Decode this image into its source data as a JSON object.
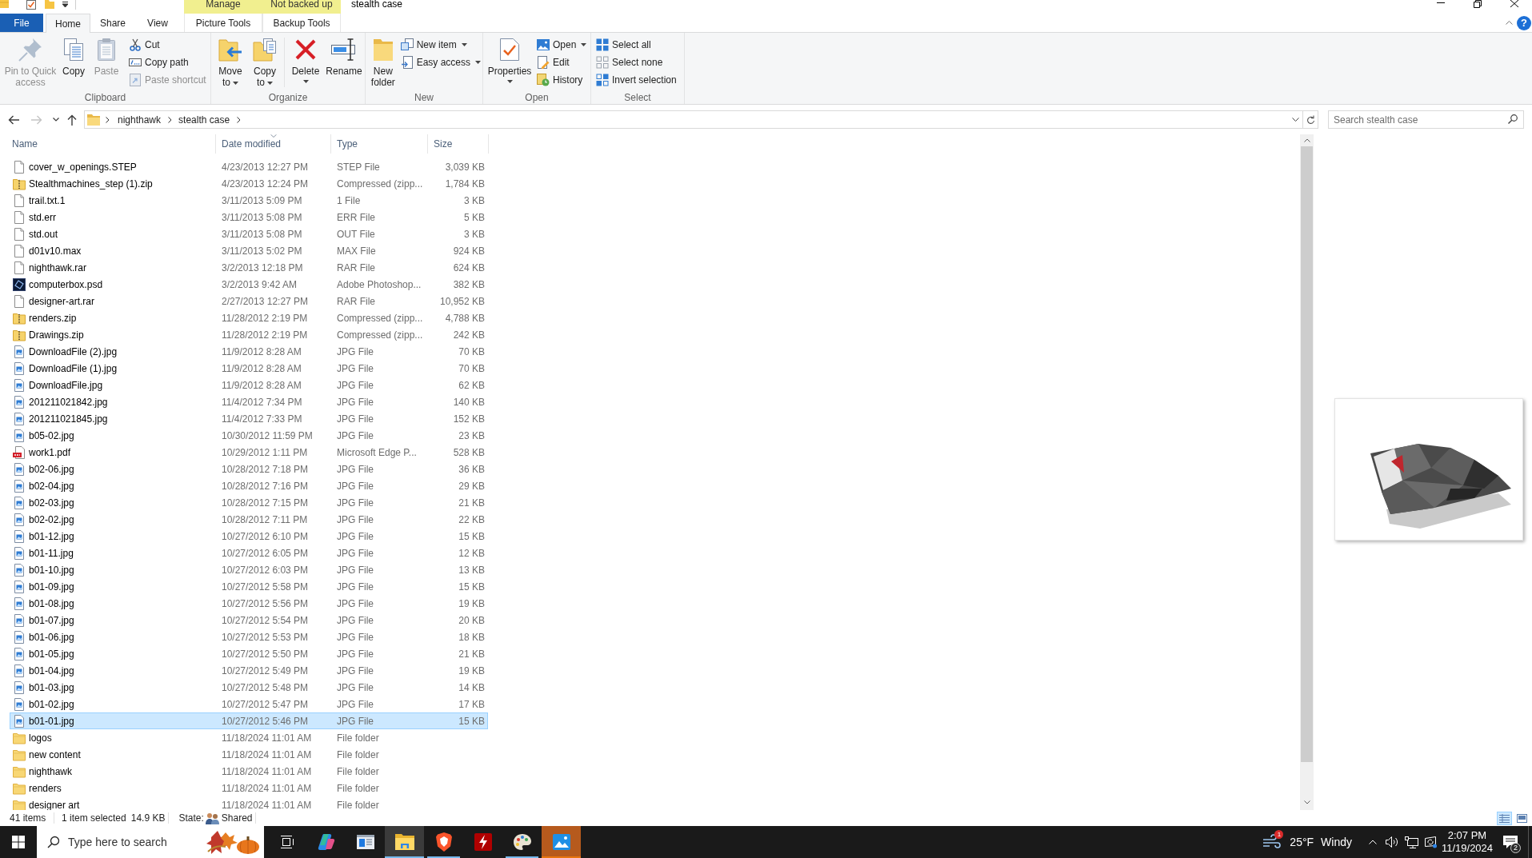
{
  "window": {
    "title": "stealth case"
  },
  "ribbon": {
    "tabs": [
      {
        "label": "File",
        "kind": "file",
        "selected": false
      },
      {
        "label": "Home",
        "kind": "standard",
        "selected": true
      },
      {
        "label": "Share",
        "kind": "standard",
        "selected": false
      },
      {
        "label": "View",
        "kind": "standard",
        "selected": false
      },
      {
        "label": "Picture Tools",
        "kind": "contextual",
        "header": "Manage",
        "selected": false
      },
      {
        "label": "Backup Tools",
        "kind": "contextual",
        "header": "Not backed up",
        "selected": false
      }
    ],
    "help_button": {
      "label": "?"
    },
    "groups": [
      {
        "label": "Clipboard",
        "buttons": [
          {
            "label": "Pin to Quick access",
            "kind": "large",
            "disabled": true
          },
          {
            "label": "Copy",
            "kind": "large",
            "disabled": false
          },
          {
            "label": "Paste",
            "kind": "large",
            "disabled": true
          },
          {
            "label": "Cut",
            "kind": "small",
            "disabled": false
          },
          {
            "label": "Copy path",
            "kind": "small",
            "disabled": false
          },
          {
            "label": "Paste shortcut",
            "kind": "small",
            "disabled": true
          }
        ]
      },
      {
        "label": "Organize",
        "buttons": [
          {
            "label": "Move to",
            "kind": "large_menu",
            "disabled": false
          },
          {
            "label": "Copy to",
            "kind": "large_menu",
            "disabled": false
          },
          {
            "label": "Delete",
            "kind": "large_split",
            "disabled": false
          },
          {
            "label": "Rename",
            "kind": "large",
            "disabled": false
          }
        ]
      },
      {
        "label": "New",
        "buttons": [
          {
            "label": "New folder",
            "kind": "large",
            "disabled": false
          },
          {
            "label": "New item",
            "kind": "small_menu",
            "disabled": false
          },
          {
            "label": "Easy access",
            "kind": "small_menu",
            "disabled": false
          }
        ]
      },
      {
        "label": "Open",
        "buttons": [
          {
            "label": "Properties",
            "kind": "large_split",
            "disabled": false
          },
          {
            "label": "Open",
            "kind": "small_menu",
            "disabled": false
          },
          {
            "label": "Edit",
            "kind": "small",
            "disabled": false
          },
          {
            "label": "History",
            "kind": "small",
            "disabled": false
          }
        ]
      },
      {
        "label": "Select",
        "buttons": [
          {
            "label": "Select all",
            "kind": "small",
            "disabled": false
          },
          {
            "label": "Select none",
            "kind": "small",
            "disabled": false
          },
          {
            "label": "Invert selection",
            "kind": "small",
            "disabled": false
          }
        ]
      }
    ]
  },
  "address_bar": {
    "nav_buttons": [
      {
        "kind": "back",
        "disabled": false
      },
      {
        "kind": "forward",
        "disabled": true
      },
      {
        "kind": "recent",
        "disabled": false
      },
      {
        "kind": "up",
        "disabled": false
      }
    ],
    "path": [
      "nighthawk",
      "stealth case"
    ]
  },
  "search": {
    "placeholder": "Search stealth case"
  },
  "file_list": {
    "columns": [
      {
        "label": "Name",
        "sorted": false
      },
      {
        "label": "Date modified",
        "sorted": true
      },
      {
        "label": "Type",
        "sorted": false
      },
      {
        "label": "Size",
        "sorted": false
      }
    ],
    "rows": [
      {
        "name": "cover_w_openings.STEP",
        "date_modified": "4/23/2013 12:27 PM",
        "type": "STEP File",
        "size": "3,039 KB",
        "kind": "document",
        "selected": false
      },
      {
        "name": "Stealthmachines_step (1).zip",
        "date_modified": "4/23/2013 12:24 PM",
        "type": "Compressed (zipp...",
        "size": "1,784 KB",
        "kind": "archive",
        "selected": false
      },
      {
        "name": "trail.txt.1",
        "date_modified": "3/11/2013 5:09 PM",
        "type": "1 File",
        "size": "3 KB",
        "kind": "document",
        "selected": false
      },
      {
        "name": "std.err",
        "date_modified": "3/11/2013 5:08 PM",
        "type": "ERR File",
        "size": "5 KB",
        "kind": "document",
        "selected": false
      },
      {
        "name": "std.out",
        "date_modified": "3/11/2013 5:08 PM",
        "type": "OUT File",
        "size": "3 KB",
        "kind": "document",
        "selected": false
      },
      {
        "name": "d01v10.max",
        "date_modified": "3/11/2013 5:02 PM",
        "type": "MAX File",
        "size": "924 KB",
        "kind": "document",
        "selected": false
      },
      {
        "name": "nighthawk.rar",
        "date_modified": "3/2/2013 12:18 PM",
        "type": "RAR File",
        "size": "624 KB",
        "kind": "document",
        "selected": false
      },
      {
        "name": "computerbox.psd",
        "date_modified": "3/2/2013 9:42 AM",
        "type": "Adobe Photoshop...",
        "size": "382 KB",
        "kind": "photoshop",
        "selected": false
      },
      {
        "name": "designer-art.rar",
        "date_modified": "2/27/2013 12:27 PM",
        "type": "RAR File",
        "size": "10,952 KB",
        "kind": "document",
        "selected": false
      },
      {
        "name": "renders.zip",
        "date_modified": "11/28/2012 2:19 PM",
        "type": "Compressed (zipp...",
        "size": "4,788 KB",
        "kind": "archive",
        "selected": false
      },
      {
        "name": "Drawings.zip",
        "date_modified": "11/28/2012 2:19 PM",
        "type": "Compressed (zipp...",
        "size": "242 KB",
        "kind": "archive",
        "selected": false
      },
      {
        "name": "DownloadFile (2).jpg",
        "date_modified": "11/9/2012 8:28 AM",
        "type": "JPG File",
        "size": "70 KB",
        "kind": "image",
        "selected": false
      },
      {
        "name": "DownloadFile (1).jpg",
        "date_modified": "11/9/2012 8:28 AM",
        "type": "JPG File",
        "size": "70 KB",
        "kind": "image",
        "selected": false
      },
      {
        "name": "DownloadFile.jpg",
        "date_modified": "11/9/2012 8:28 AM",
        "type": "JPG File",
        "size": "62 KB",
        "kind": "image",
        "selected": false
      },
      {
        "name": "201211021842.jpg",
        "date_modified": "11/4/2012 7:34 PM",
        "type": "JPG File",
        "size": "140 KB",
        "kind": "image",
        "selected": false
      },
      {
        "name": "201211021845.jpg",
        "date_modified": "11/4/2012 7:33 PM",
        "type": "JPG File",
        "size": "152 KB",
        "kind": "image",
        "selected": false
      },
      {
        "name": "b05-02.jpg",
        "date_modified": "10/30/2012 11:59 PM",
        "type": "JPG File",
        "size": "23 KB",
        "kind": "image",
        "selected": false
      },
      {
        "name": "work1.pdf",
        "date_modified": "10/29/2012 1:11 PM",
        "type": "Microsoft Edge P...",
        "size": "528 KB",
        "kind": "pdf",
        "selected": false
      },
      {
        "name": "b02-06.jpg",
        "date_modified": "10/28/2012 7:18 PM",
        "type": "JPG File",
        "size": "36 KB",
        "kind": "image",
        "selected": false
      },
      {
        "name": "b02-04.jpg",
        "date_modified": "10/28/2012 7:16 PM",
        "type": "JPG File",
        "size": "29 KB",
        "kind": "image",
        "selected": false
      },
      {
        "name": "b02-03.jpg",
        "date_modified": "10/28/2012 7:15 PM",
        "type": "JPG File",
        "size": "21 KB",
        "kind": "image",
        "selected": false
      },
      {
        "name": "b02-02.jpg",
        "date_modified": "10/28/2012 7:11 PM",
        "type": "JPG File",
        "size": "22 KB",
        "kind": "image",
        "selected": false
      },
      {
        "name": "b01-12.jpg",
        "date_modified": "10/27/2012 6:10 PM",
        "type": "JPG File",
        "size": "15 KB",
        "kind": "image",
        "selected": false
      },
      {
        "name": "b01-11.jpg",
        "date_modified": "10/27/2012 6:05 PM",
        "type": "JPG File",
        "size": "12 KB",
        "kind": "image",
        "selected": false
      },
      {
        "name": "b01-10.jpg",
        "date_modified": "10/27/2012 6:03 PM",
        "type": "JPG File",
        "size": "13 KB",
        "kind": "image",
        "selected": false
      },
      {
        "name": "b01-09.jpg",
        "date_modified": "10/27/2012 5:58 PM",
        "type": "JPG File",
        "size": "15 KB",
        "kind": "image",
        "selected": false
      },
      {
        "name": "b01-08.jpg",
        "date_modified": "10/27/2012 5:56 PM",
        "type": "JPG File",
        "size": "19 KB",
        "kind": "image",
        "selected": false
      },
      {
        "name": "b01-07.jpg",
        "date_modified": "10/27/2012 5:54 PM",
        "type": "JPG File",
        "size": "20 KB",
        "kind": "image",
        "selected": false
      },
      {
        "name": "b01-06.jpg",
        "date_modified": "10/27/2012 5:53 PM",
        "type": "JPG File",
        "size": "18 KB",
        "kind": "image",
        "selected": false
      },
      {
        "name": "b01-05.jpg",
        "date_modified": "10/27/2012 5:50 PM",
        "type": "JPG File",
        "size": "21 KB",
        "kind": "image",
        "selected": false
      },
      {
        "name": "b01-04.jpg",
        "date_modified": "10/27/2012 5:49 PM",
        "type": "JPG File",
        "size": "19 KB",
        "kind": "image",
        "selected": false
      },
      {
        "name": "b01-03.jpg",
        "date_modified": "10/27/2012 5:48 PM",
        "type": "JPG File",
        "size": "14 KB",
        "kind": "image",
        "selected": false
      },
      {
        "name": "b01-02.jpg",
        "date_modified": "10/27/2012 5:47 PM",
        "type": "JPG File",
        "size": "17 KB",
        "kind": "image",
        "selected": false
      },
      {
        "name": "b01-01.jpg",
        "date_modified": "10/27/2012 5:46 PM",
        "type": "JPG File",
        "size": "15 KB",
        "kind": "image",
        "selected": true
      },
      {
        "name": "logos",
        "date_modified": "11/18/2024 11:01 AM",
        "type": "File folder",
        "kind": "folder",
        "selected": false
      },
      {
        "name": "new content",
        "date_modified": "11/18/2024 11:01 AM",
        "type": "File folder",
        "kind": "folder",
        "selected": false
      },
      {
        "name": "nighthawk",
        "date_modified": "11/18/2024 11:01 AM",
        "type": "File folder",
        "kind": "folder",
        "selected": false
      },
      {
        "name": "renders",
        "date_modified": "11/18/2024 11:01 AM",
        "type": "File folder",
        "kind": "folder",
        "selected": false
      },
      {
        "name": "designer art",
        "date_modified": "11/18/2024 11:01 AM",
        "type": "File folder",
        "kind": "folder",
        "selected": false
      }
    ]
  },
  "status_bar": {
    "item_count": "41 items",
    "selection": "1 item selected",
    "selection_size": "14.9 KB",
    "state_label": "State:",
    "state_value": "Shared",
    "view_modes": [
      {
        "kind": "details",
        "selected": true
      },
      {
        "kind": "large_icons",
        "selected": false
      }
    ]
  },
  "taskbar": {
    "search": {
      "placeholder": "Type here to search"
    },
    "apps": [
      {
        "running": false,
        "active": false,
        "flashing": false
      },
      {
        "running": false,
        "active": false,
        "flashing": false
      },
      {
        "running": true,
        "active": true,
        "flashing": false
      },
      {
        "running": true,
        "active": false,
        "flashing": false
      },
      {
        "running": false,
        "active": false,
        "flashing": false
      },
      {
        "running": true,
        "active": false,
        "flashing": false
      },
      {
        "running": true,
        "active": false,
        "flashing": true
      }
    ],
    "weather": {
      "badge": "1",
      "temperature": "25°F",
      "condition": "Windy"
    },
    "clock": {
      "time": "2:07 PM",
      "date": "11/19/2024"
    },
    "notifications": {
      "badge": "2"
    }
  }
}
